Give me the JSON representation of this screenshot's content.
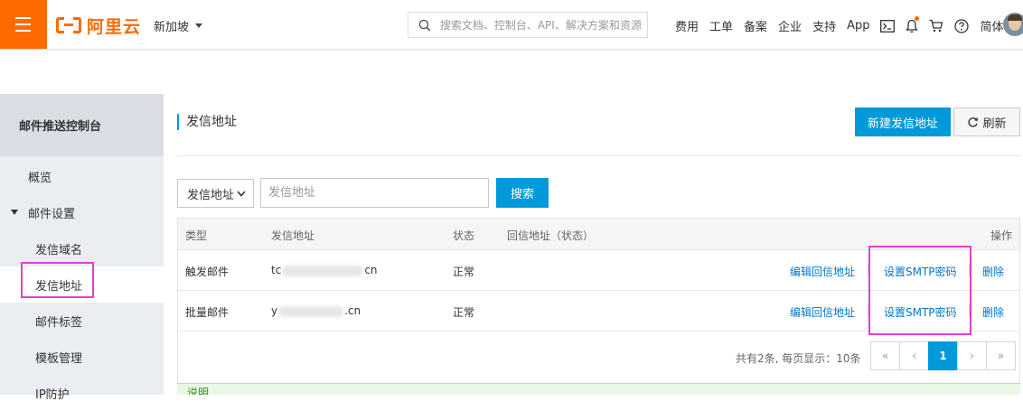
{
  "topbar": {
    "logo_text": "阿里云",
    "region": "新加坡",
    "search_placeholder": "搜索文档、控制台、API、解决方案和资源",
    "links": [
      "费用",
      "工单",
      "备案",
      "企业",
      "支持",
      "App"
    ],
    "lang": "简体",
    "brand_color": "#ff6a00"
  },
  "sidebar": {
    "title": "邮件推送控制台",
    "items": [
      {
        "label": "概览"
      },
      {
        "label": "邮件设置"
      },
      {
        "label": "发信域名"
      },
      {
        "label": "发信地址"
      },
      {
        "label": "邮件标签"
      },
      {
        "label": "模板管理"
      },
      {
        "label": "IP防护"
      }
    ],
    "active_item": "发信地址"
  },
  "main": {
    "title": "发信地址",
    "create_button": "新建发信地址",
    "refresh_button": "刷新",
    "filter": {
      "select_value": "发信地址",
      "input_placeholder": "发信地址",
      "search_button": "搜索"
    },
    "table": {
      "headers": [
        "类型",
        "发信地址",
        "状态",
        "回信地址（状态）",
        "操作"
      ],
      "rows": [
        {
          "type": "触发邮件",
          "addr_start": "tc",
          "addr_end": "cn",
          "status": "正常",
          "reply": "",
          "act_edit": "编辑回信地址",
          "act_smtp": "设置SMTP密码",
          "act_delete": "删除"
        },
        {
          "type": "批量邮件",
          "addr_start": "y",
          "addr_end": ".cn",
          "status": "正常",
          "reply": "",
          "act_edit": "编辑回信地址",
          "act_smtp": "设置SMTP密码",
          "act_delete": "删除"
        }
      ]
    },
    "pagination": {
      "info": "共有2条, 每页显示：10条",
      "first": "«",
      "prev": "‹",
      "current": "1",
      "next": "›",
      "last": "»"
    },
    "notice_title": "说明"
  },
  "accent_color": "#0099d9",
  "highlight_color": "#e040d0"
}
